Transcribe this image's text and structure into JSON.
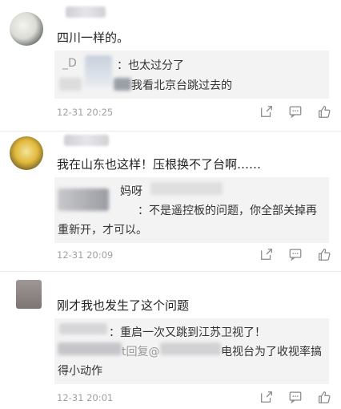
{
  "comments": [
    {
      "text": "四川一样的。",
      "replies": [
        {
          "prefix": "_D",
          "text": "：也太过分了"
        },
        {
          "text": "我看北京台跳过去的"
        }
      ],
      "time": "12-31 20:25"
    },
    {
      "text": "我在山东也这样！压根换不了台啊……",
      "replies": [
        {
          "text": "妈呀"
        },
        {
          "text": "：不是遥控板的问题，你全部关掉再"
        },
        {
          "text": "重新开，才可以。"
        }
      ],
      "time": "12-31 20:09"
    },
    {
      "text": "刚才我也发生了这个问题",
      "replies": [
        {
          "text": "：重启一次又跳到江苏卫视了！"
        },
        {
          "prefix": "t回复@",
          "text": "电视台为了收视率搞"
        },
        {
          "text": "得小动作"
        }
      ],
      "time": "12-31 20:01"
    }
  ],
  "actions": [
    "share-icon",
    "comment-icon",
    "like-icon"
  ]
}
